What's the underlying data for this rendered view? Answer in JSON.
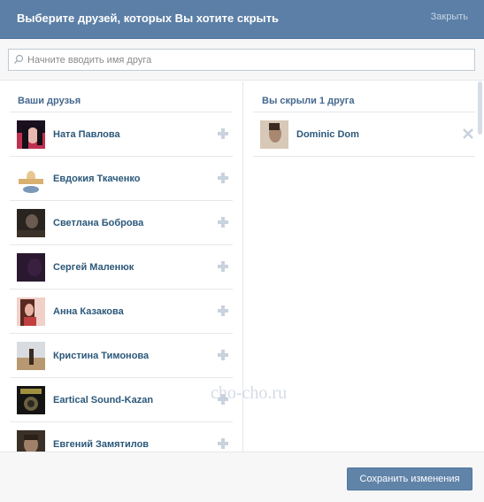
{
  "header": {
    "title": "Выберите друзей, которых Вы хотите скрыть",
    "close_label": "Закрыть",
    "bg_color": "#5b7fa6"
  },
  "search": {
    "placeholder": "Начните вводить имя друга",
    "value": "",
    "icon": "search-icon"
  },
  "friends_column": {
    "title": "Ваши друзья",
    "items": [
      {
        "name": "Ната Павлова",
        "avatar_color": "#1a1020",
        "action_icon": "plus-icon"
      },
      {
        "name": "Евдокия Ткаченко",
        "avatar_color": "#e8c890",
        "action_icon": "plus-icon"
      },
      {
        "name": "Светлана Боброва",
        "avatar_color": "#2a2420",
        "action_icon": "plus-icon"
      },
      {
        "name": "Сергей Маленюк",
        "avatar_color": "#2a1830",
        "action_icon": "plus-icon"
      },
      {
        "name": "Анна Казакова",
        "avatar_color": "#8a4a3a",
        "action_icon": "plus-icon"
      },
      {
        "name": "Кристина Тимонова",
        "avatar_color": "#b8a080",
        "action_icon": "plus-icon"
      },
      {
        "name": "Eartical Sound-Kazan",
        "avatar_color": "#1a1a18",
        "action_icon": "plus-icon"
      },
      {
        "name": "Евгений Замятилов",
        "avatar_color": "#5a4a40",
        "action_icon": "plus-icon"
      }
    ]
  },
  "hidden_column": {
    "title": "Вы скрыли 1 друга",
    "items": [
      {
        "name": "Dominic Dom",
        "avatar_color": "#a88870",
        "action_icon": "close-icon"
      }
    ]
  },
  "footer": {
    "save_label": "Сохранить изменения"
  },
  "watermark": "cho-cho.ru",
  "colors": {
    "link": "#2b587a",
    "title": "#45688e",
    "button": "#6083a8",
    "divider": "#e4e7ea"
  }
}
